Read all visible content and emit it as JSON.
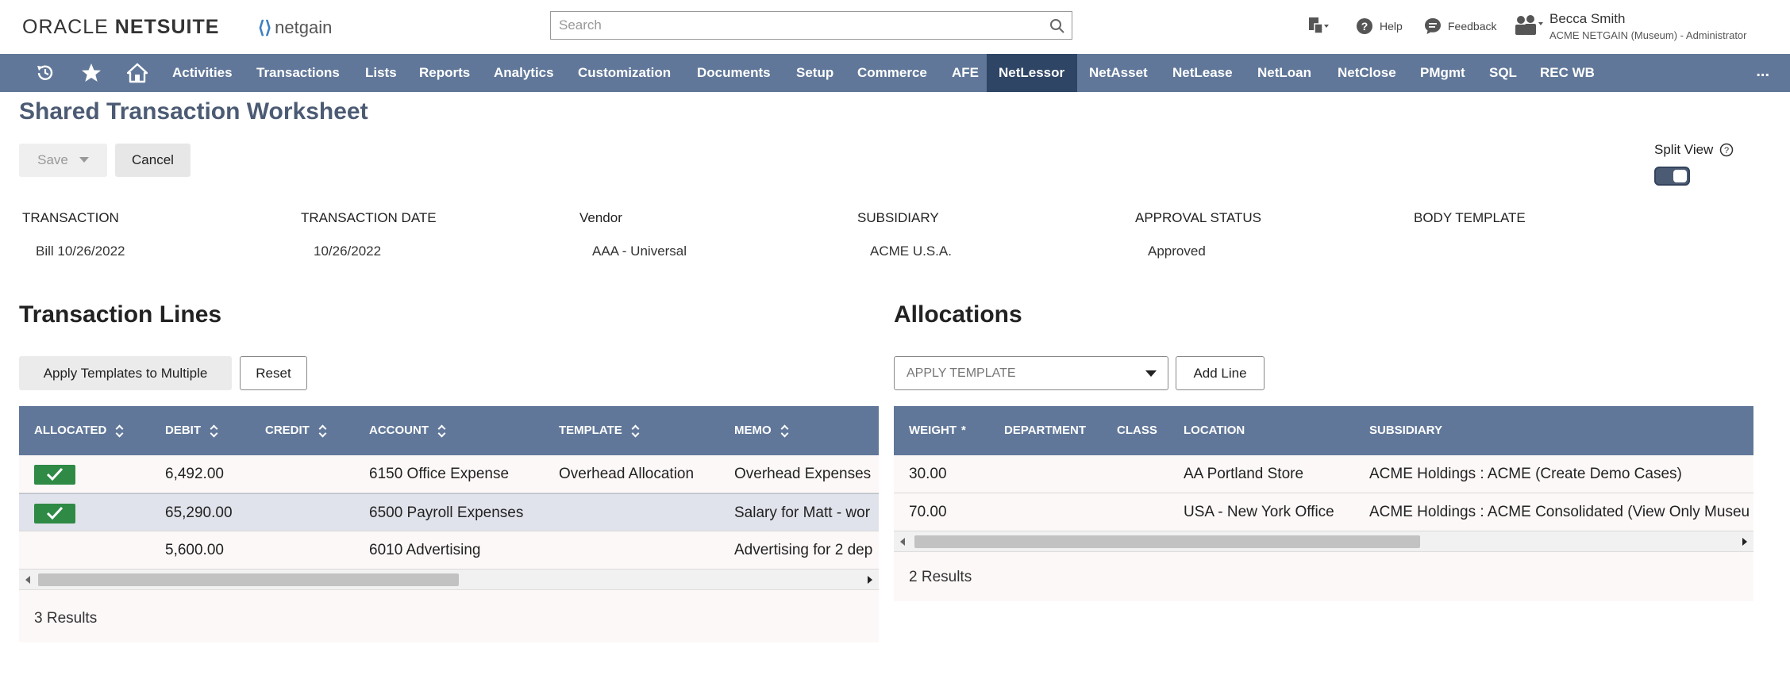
{
  "header": {
    "brand_oracle": "ORACLE",
    "brand_netsuite": "NETSUITE",
    "brand_netgain": "netgain",
    "search_placeholder": "Search",
    "help": "Help",
    "feedback": "Feedback",
    "user_name": "Becca Smith",
    "user_role": "ACME NETGAIN (Museum) - Administrator"
  },
  "nav": {
    "items": [
      "Activities",
      "Transactions",
      "Lists",
      "Reports",
      "Analytics",
      "Customization",
      "Documents",
      "Setup",
      "Commerce",
      "AFE",
      "NetLessor",
      "NetAsset",
      "NetLease",
      "NetLoan",
      "NetClose",
      "PMgmt",
      "SQL",
      "REC WB"
    ],
    "active": "NetLessor",
    "more": "..."
  },
  "page": {
    "title": "Shared Transaction Worksheet",
    "save_label": "Save",
    "cancel_label": "Cancel",
    "split_view_label": "Split View",
    "split_view_on": true
  },
  "fields": [
    {
      "label": "TRANSACTION",
      "value": "Bill 10/26/2022"
    },
    {
      "label": "TRANSACTION DATE",
      "value": "10/26/2022"
    },
    {
      "label": "Vendor",
      "value": "AAA - Universal"
    },
    {
      "label": "SUBSIDIARY",
      "value": "ACME U.S.A."
    },
    {
      "label": "APPROVAL STATUS",
      "value": "Approved"
    },
    {
      "label": "BODY TEMPLATE",
      "value": ""
    }
  ],
  "transaction_lines": {
    "title": "Transaction Lines",
    "apply_label": "Apply Templates to Multiple",
    "reset_label": "Reset",
    "columns": [
      "ALLOCATED",
      "DEBIT",
      "CREDIT",
      "ACCOUNT",
      "TEMPLATE",
      "MEMO"
    ],
    "rows": [
      {
        "allocated": true,
        "debit": "6,492.00",
        "credit": "",
        "account": "6150 Office Expense",
        "template": "Overhead Allocation",
        "memo": "Overhead Expenses"
      },
      {
        "allocated": true,
        "debit": "65,290.00",
        "credit": "",
        "account": "6500 Payroll Expenses",
        "template": "",
        "memo": "Salary for Matt - wor"
      },
      {
        "allocated": false,
        "debit": "5,600.00",
        "credit": "",
        "account": "6010 Advertising",
        "template": "",
        "memo": "Advertising for 2 dep"
      }
    ],
    "results": "3 Results"
  },
  "allocations": {
    "title": "Allocations",
    "template_placeholder": "APPLY TEMPLATE",
    "add_line_label": "Add Line",
    "columns": [
      "WEIGHT",
      "DEPARTMENT",
      "CLASS",
      "LOCATION",
      "SUBSIDIARY"
    ],
    "required_mark": "*",
    "rows": [
      {
        "weight": "30.00",
        "department": "",
        "class": "",
        "location": "AA Portland Store",
        "subsidiary": "ACME Holdings : ACME (Create Demo Cases)"
      },
      {
        "weight": "70.00",
        "department": "",
        "class": "",
        "location": "USA - New York Office",
        "subsidiary": "ACME Holdings : ACME Consolidated (View Only Museu"
      }
    ],
    "results": "2 Results"
  },
  "colors": {
    "nav_bg": "#607799",
    "nav_active": "#2e4565",
    "table_header": "#607799",
    "check_green": "#2f8a46",
    "title_color": "#4c5b74"
  }
}
